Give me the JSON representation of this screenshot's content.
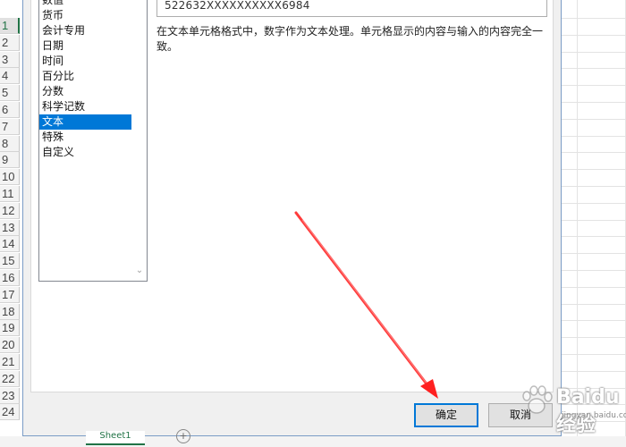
{
  "row_headers": [
    "1",
    "2",
    "3",
    "4",
    "5",
    "6",
    "7",
    "8",
    "9",
    "10",
    "11",
    "12",
    "13",
    "14",
    "15",
    "16",
    "17",
    "18",
    "19",
    "20",
    "21",
    "22",
    "23",
    "24"
  ],
  "dialog": {
    "categories": [
      {
        "label": "数值"
      },
      {
        "label": "货币"
      },
      {
        "label": "会计专用"
      },
      {
        "label": "日期"
      },
      {
        "label": "时间"
      },
      {
        "label": "百分比"
      },
      {
        "label": "分数"
      },
      {
        "label": "科学记数"
      },
      {
        "label": "文本",
        "selected": true
      },
      {
        "label": "特殊"
      },
      {
        "label": "自定义"
      }
    ],
    "sample_value": "522632XXXXXXXXXX6984",
    "description": "在文本单元格格式中，数字作为文本处理。单元格显示的内容与输入的内容完全一致。",
    "ok_label": "确定",
    "cancel_label": "取消"
  },
  "sheet_tab_label": "Sheet1",
  "watermark": {
    "text": "Baidu经验",
    "sub": "jingyan.baidu.com"
  },
  "colors": {
    "selection": "#0078d7",
    "excel_green": "#217346",
    "annotation_arrow": "#ff3b3b"
  }
}
